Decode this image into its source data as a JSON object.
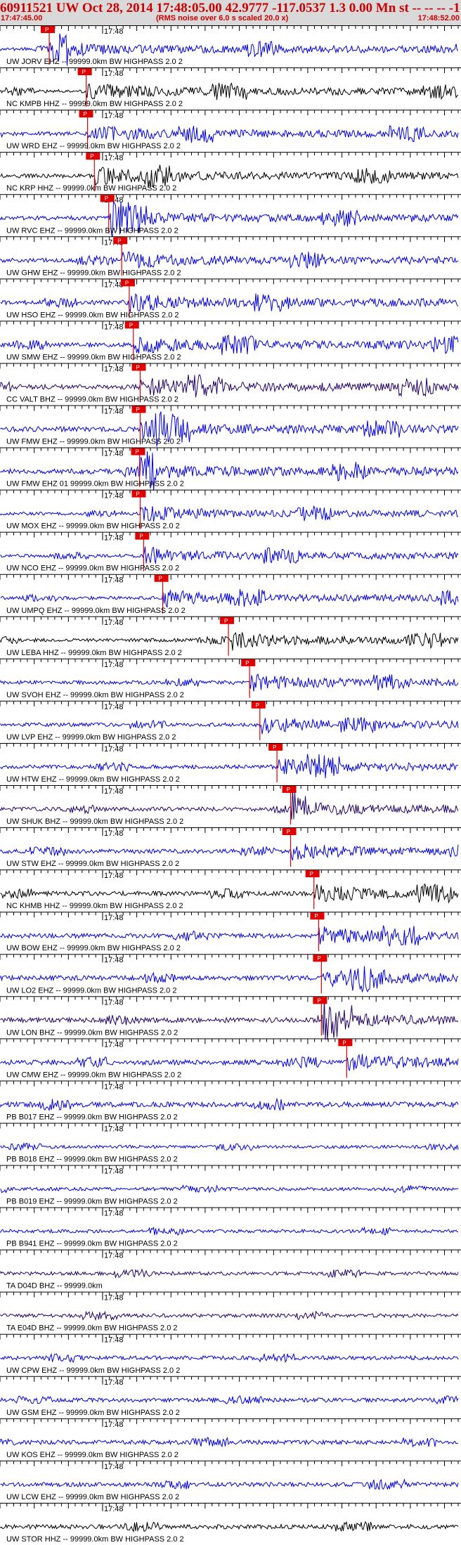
{
  "header": {
    "title": "60911521 UW Oct 28, 2014 17:48:05.00   42.9777 -117.0537  1.3 0.00 Mn st -- -- -- -1",
    "start_time": "17:47:45.00",
    "end_time": "17:48:52.00",
    "rms_note": "(RMS noise over 6.0 s scaled 20.0 x)"
  },
  "colors": {
    "header_bg": "#d9d9d9",
    "header_text": "#cc0000",
    "pick": "#e00000",
    "tick": "#000000"
  },
  "chart_data": {
    "type": "line",
    "title": "60911521 UW Oct 28, 2014 17:48:05.00   42.9777 -117.0537  1.3 0.00 Mn st -- -- -- -1",
    "xlabel": "",
    "ylabel": "",
    "x_range": [
      "17:47:45.00",
      "17:48:52.00"
    ],
    "minute_tick_label": "17:48",
    "pick_label": "P",
    "grid": false,
    "traces": [
      {
        "label": "UW JORV EHZ -- 99999.0km BW  HIGHPASS  2.0  2",
        "color": "#0000dd",
        "pick": "17:47:52.2"
      },
      {
        "label": "NC KMPB HHZ -- 99999.0km BW  HIGHPASS  2.0  2",
        "color": "#000000",
        "pick": "17:47:57.6"
      },
      {
        "label": "UW WRD EHZ -- 99999.0km BW  HIGHPASS  2.0  2",
        "color": "#0000dd",
        "pick": "17:47:57.8"
      },
      {
        "label": "NC KRP HHZ -- 99999.0km BW  HIGHPASS  2.0  2",
        "color": "#000000",
        "pick": "17:47:58.8"
      },
      {
        "label": "UW RVC EHZ -- 99999.0km BW  HIGHPASS  2.0  2",
        "color": "#0000dd",
        "pick": "17:48:00.9"
      },
      {
        "label": "UW GHW EHZ -- 99999.0km BW  HIGHPASS  2.0  2",
        "color": "#0000dd",
        "pick": "17:48:02.8"
      },
      {
        "label": "UW HSO EHZ -- 99999.0km BW  HIGHPASS  2.0  2",
        "color": "#0000dd",
        "pick": "17:48:03.9"
      },
      {
        "label": "UW SMW EHZ -- 99999.0km BW  HIGHPASS  2.0  2",
        "color": "#0000dd",
        "pick": "17:48:04.5"
      },
      {
        "label": "CC VALT BHZ -- 99999.0km BW  HIGHPASS  2.0  2",
        "color": "#220066",
        "pick": "17:48:05.5"
      },
      {
        "label": "UW FMW EHZ -- 99999.0km BW  HIGHPASS  2.0  2",
        "color": "#0000dd",
        "pick": "17:48:05.5"
      },
      {
        "label": "UW FMW EHZ 01 99999.0km BW  HIGHPASS  2.0  2",
        "color": "#0000dd",
        "pick": "17:48:05.4"
      },
      {
        "label": "UW MOX EHZ -- 99999.0km BW  HIGHPASS  2.0  2",
        "color": "#0000dd",
        "pick": "17:48:05.5"
      },
      {
        "label": "UW NCO EHZ -- 99999.0km BW  HIGHPASS  2.0  2",
        "color": "#0000dd",
        "pick": "17:48:06.0"
      },
      {
        "label": "UW UMPQ EHZ -- 99999.0km BW  HIGHPASS  2.0  2",
        "color": "#0000dd",
        "pick": "17:48:08.8"
      },
      {
        "label": "UW LEBA HHZ -- 99999.0km BW  HIGHPASS  2.0  2",
        "color": "#000000",
        "pick": "17:48:18.4"
      },
      {
        "label": "UW SVOH EHZ -- 99999.0km BW  HIGHPASS  2.0  2",
        "color": "#0000dd",
        "pick": "17:48:21.5"
      },
      {
        "label": "UW LVP EHZ -- 99999.0km BW  HIGHPASS  2.0  2",
        "color": "#0000dd",
        "pick": "17:48:23.0"
      },
      {
        "label": "UW HTW EHZ -- 99999.0km BW  HIGHPASS  2.0  2",
        "color": "#0000dd",
        "pick": "17:48:25.5"
      },
      {
        "label": "UW SHUK BHZ -- 99999.0km BW  HIGHPASS  2.0  2",
        "color": "#220066",
        "pick": "17:48:27.5"
      },
      {
        "label": "UW STW EHZ -- 99999.0km BW  HIGHPASS  2.0  2",
        "color": "#0000dd",
        "pick": "17:48:27.5"
      },
      {
        "label": "NC KHMB HHZ -- 99999.0km BW  HIGHPASS  2.0  2",
        "color": "#000000",
        "pick": "17:48:30.9"
      },
      {
        "label": "UW BOW EHZ -- 99999.0km BW  HIGHPASS  2.0  2",
        "color": "#0000dd",
        "pick": "17:48:31.6"
      },
      {
        "label": "UW LO2 EHZ -- 99999.0km BW  HIGHPASS  2.0  2",
        "color": "#0000dd",
        "pick": "17:48:32.0"
      },
      {
        "label": "UW LON BHZ -- 99999.0km BW  HIGHPASS  2.0  2",
        "color": "#220066",
        "pick": "17:48:32.0"
      },
      {
        "label": "UW CMW EHZ -- 99999.0km BW  HIGHPASS  2.0  2",
        "color": "#0000dd",
        "pick": "17:48:35.7"
      },
      {
        "label": "PB B017 EHZ -- 99999.0km BW  HIGHPASS  2.0  2",
        "color": "#0000dd",
        "pick": null
      },
      {
        "label": "PB B018 EHZ -- 99999.0km BW  HIGHPASS  2.0  2",
        "color": "#0000dd",
        "pick": null
      },
      {
        "label": "PB B019 EHZ -- 99999.0km BW  HIGHPASS  2.0  2",
        "color": "#0000dd",
        "pick": null
      },
      {
        "label": "PB B941 EHZ -- 99999.0km BW  HIGHPASS  2.0  2",
        "color": "#0000dd",
        "pick": null
      },
      {
        "label": "TA D04D BHZ -- 99999.0km",
        "color": "#220066",
        "pick": null
      },
      {
        "label": "TA E04D BHZ -- 99999.0km BW  HIGHPASS  2.0  2",
        "color": "#220066",
        "pick": null
      },
      {
        "label": "UW CPW EHZ -- 99999.0km BW  HIGHPASS  2.0  2",
        "color": "#0000dd",
        "pick": null
      },
      {
        "label": "UW GSM EHZ -- 99999.0km BW  HIGHPASS  2.0  2",
        "color": "#0000dd",
        "pick": null
      },
      {
        "label": "UW KOS EHZ -- 99999.0km BW  HIGHPASS  2.0  2",
        "color": "#0000dd",
        "pick": null
      },
      {
        "label": "UW LCW EHZ -- 99999.0km BW  HIGHPASS  2.0  2",
        "color": "#0000dd",
        "pick": null
      },
      {
        "label": "UW STOR HHZ -- 99999.0km BW  HIGHPASS  2.0  2",
        "color": "#000000",
        "pick": null
      }
    ]
  }
}
